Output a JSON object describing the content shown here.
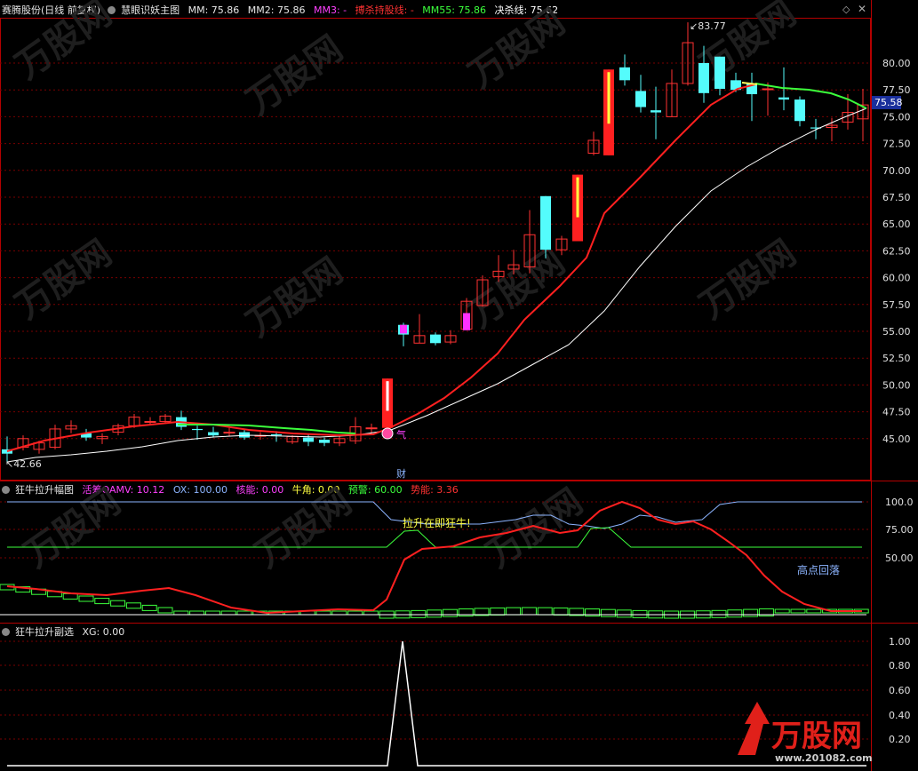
{
  "main_header": {
    "stock": "赛腾股份(日线 前复权)",
    "indicator": "慧眼识妖主图",
    "mm": "MM: 75.86",
    "mm2": "MM2: 75.86",
    "mm3": "MM3: -",
    "bosha": "搏杀持股线: -",
    "mm55": "MM55: 75.86",
    "juesha": "决杀线: 75.62"
  },
  "main_axis": {
    "labels": [
      "80.00",
      "77.50",
      "75.00",
      "72.50",
      "70.00",
      "67.50",
      "65.00",
      "62.50",
      "60.00",
      "57.50",
      "55.00",
      "52.50",
      "50.00",
      "47.50",
      "45.00"
    ],
    "current_price": "75.58"
  },
  "annotations": {
    "high": "83.77",
    "low": "42.66",
    "qi": "气",
    "cai": "财"
  },
  "sub1_header": {
    "name": "狂牛拉升幅图",
    "huochou": "活筹OAMV: 10.12",
    "ox": "OX: 100.00",
    "heneng": "核能: 0.00",
    "niujiao": "牛角: 0.00",
    "yujing": "预警: 60.00",
    "shineng": "势能: 3.36"
  },
  "sub1_axis": [
    "100.0",
    "75.00",
    "50.00"
  ],
  "sub1_notes": {
    "lasheng": "拉升在即狂牛!",
    "gaodian": "高点回落"
  },
  "sub2_header": {
    "name": "狂牛拉升副选",
    "xg": "XG: 0.00"
  },
  "sub2_axis": [
    "1.00",
    "0.80",
    "0.60",
    "0.40",
    "0.20"
  ],
  "watermark": {
    "brand": "万股网",
    "url": "www.201082.com"
  },
  "colors": {
    "up": "#ff3232",
    "down": "#54fcfc",
    "grid": "#7a0000"
  }
}
